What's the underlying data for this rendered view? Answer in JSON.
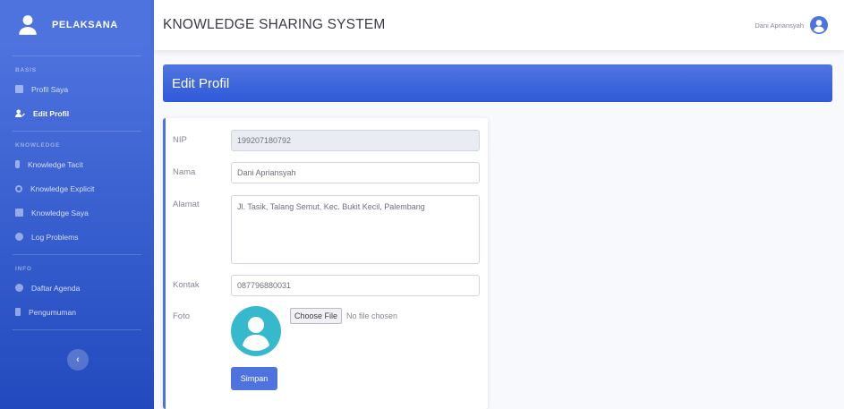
{
  "sidebar": {
    "brand": "PELAKSANA",
    "section_1": "BASIS",
    "section_2": "KNOWLEDGE",
    "section_3": "INFO",
    "items": [
      {
        "label": "Profil Saya"
      },
      {
        "label": "Edit Profil"
      },
      {
        "label": "Knowledge Tacit"
      },
      {
        "label": "Knowledge Explicit"
      },
      {
        "label": "Knowledge Saya"
      },
      {
        "label": "Log Problems"
      },
      {
        "label": "Daftar Agenda"
      },
      {
        "label": "Pengumuman"
      }
    ],
    "toggle_glyph": "‹"
  },
  "topbar": {
    "title": "KNOWLEDGE SHARING SYSTEM",
    "user_name": "Dani Apriansyah"
  },
  "page": {
    "title": "Edit Profil"
  },
  "form": {
    "nip_label": "NIP",
    "nip_value": "199207180792",
    "nama_label": "Nama",
    "nama_value": "Dani Apriansyah",
    "alamat_label": "Alamat",
    "alamat_value": "Jl. Tasik, Talang Semut, Kec. Bukit Kecil, Palembang",
    "kontak_label": "Kontak",
    "kontak_value": "087796880031",
    "foto_label": "Foto",
    "file_button": "Choose File",
    "file_status": "No file chosen",
    "save_label": "Simpan"
  },
  "colors": {
    "primary": "#4e73df",
    "primary_dark": "#224abe",
    "avatar": "#36b9cc"
  }
}
